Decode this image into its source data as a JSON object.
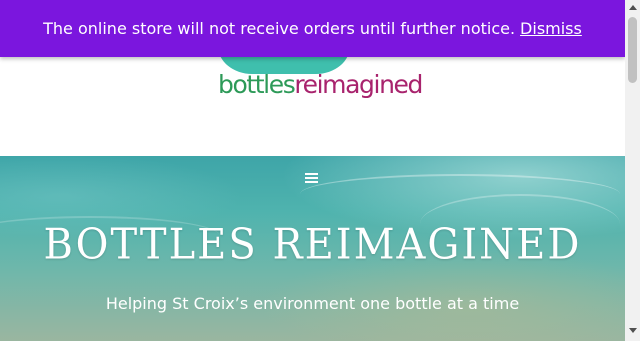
{
  "notice": {
    "message": "The online store will not receive orders until further notice.",
    "dismiss_label": "Dismiss"
  },
  "header": {
    "logo_word_1": "bottles",
    "logo_word_2": "reimagined"
  },
  "hero": {
    "menu_icon": "hamburger-menu-icon",
    "title": "BOTTLES REIMAGINED",
    "subtitle": "Helping St Croix’s environment one bottle at a time"
  },
  "colors": {
    "notice_bg": "#7b16de",
    "logo_green": "#2d9a58",
    "logo_magenta": "#a8236d",
    "logo_teal": "#3fbfad"
  }
}
